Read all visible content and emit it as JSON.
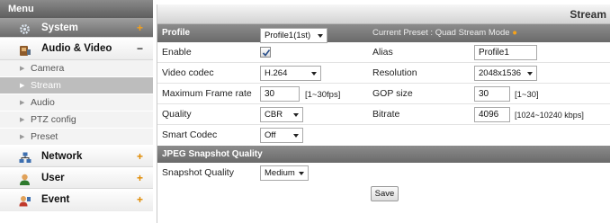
{
  "sidebar": {
    "header": "Menu",
    "categories": [
      {
        "label": "System",
        "sign": "+"
      },
      {
        "label": "Audio & Video",
        "sign": "−"
      },
      {
        "label": "Network",
        "sign": "+"
      },
      {
        "label": "User",
        "sign": "+"
      },
      {
        "label": "Event",
        "sign": "+"
      }
    ],
    "subitems": [
      {
        "label": "Camera"
      },
      {
        "label": "Stream"
      },
      {
        "label": "Audio"
      },
      {
        "label": "PTZ config"
      },
      {
        "label": "Preset"
      }
    ]
  },
  "main": {
    "title": "Stream",
    "profile": {
      "label": "Profile",
      "value": "Profile1(1st)",
      "current_preset": "Current Preset : Quad Stream Mode"
    },
    "enable": {
      "label": "Enable",
      "checked": true
    },
    "alias": {
      "label": "Alias",
      "value": "Profile1"
    },
    "video_codec": {
      "label": "Video codec",
      "value": "H.264"
    },
    "resolution": {
      "label": "Resolution",
      "value": "2048x1536"
    },
    "max_frame_rate": {
      "label": "Maximum Frame rate",
      "value": "30",
      "range": "[1~30fps]"
    },
    "gop_size": {
      "label": "GOP size",
      "value": "30",
      "range": "[1~30]"
    },
    "quality": {
      "label": "Quality",
      "value": "CBR"
    },
    "bitrate": {
      "label": "Bitrate",
      "value": "4096",
      "range": "[1024~10240 kbps]"
    },
    "smart_codec": {
      "label": "Smart Codec",
      "value": "Off"
    },
    "jpeg_section": {
      "label": "JPEG Snapshot Quality"
    },
    "snapshot_quality": {
      "label": "Snapshot Quality",
      "value": "Medium"
    },
    "save_label": "Save"
  },
  "colors": {
    "accent": "#f6a21a",
    "header_gray": "#6a6a6a",
    "active_menu": "#7a7a7a",
    "selected_subitem": "#bdbdbd"
  },
  "icons": {
    "system": "gear-icon",
    "audio_video": "camera-icon",
    "network": "network-icon",
    "user": "user-icon",
    "event": "event-icon",
    "current_preset": "orange-dot-icon",
    "enable": "checkbox-checked-icon"
  }
}
